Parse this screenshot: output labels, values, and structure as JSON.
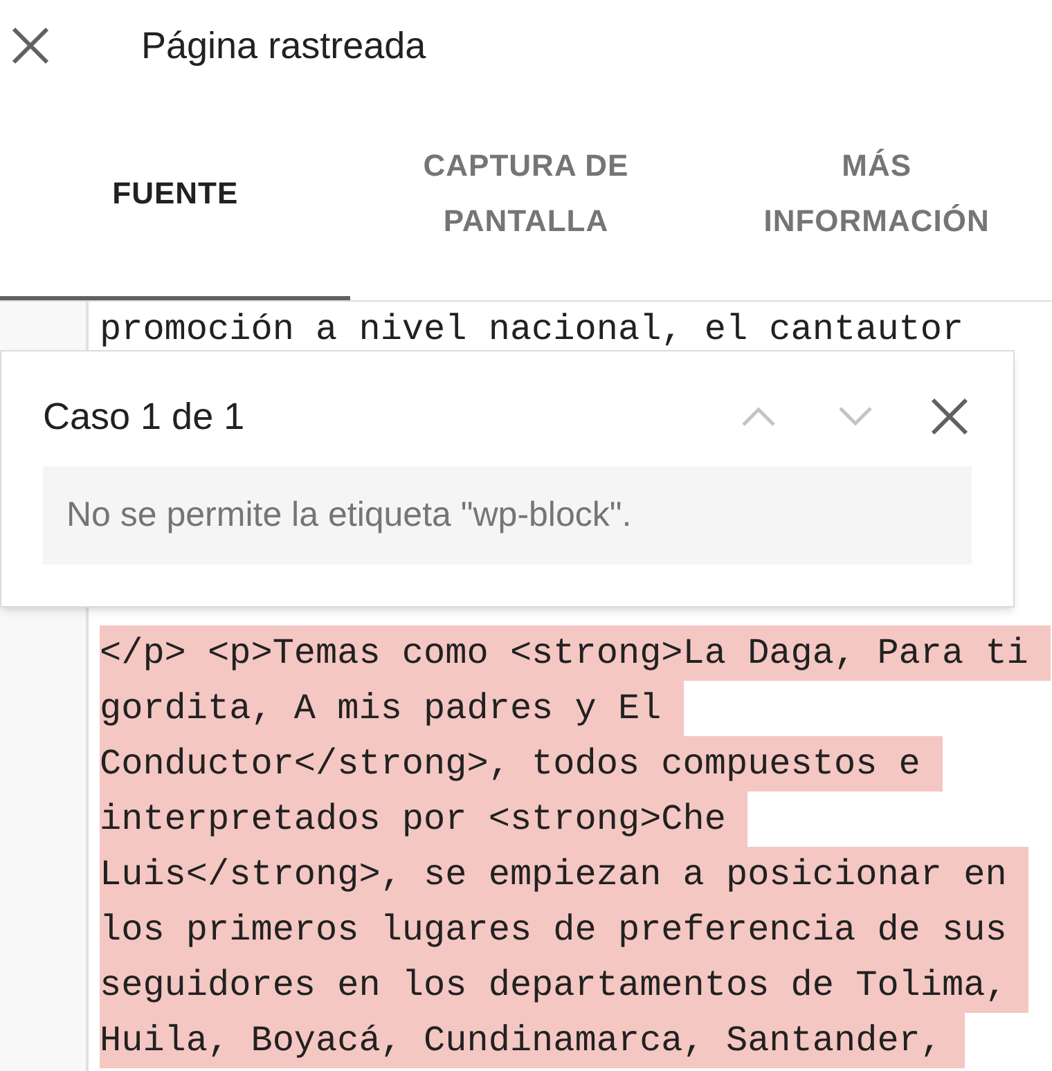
{
  "header": {
    "title": "Página rastreada"
  },
  "tabs": [
    {
      "label": "FUENTE",
      "selected": true
    },
    {
      "label": "CAPTURA DE PANTALLA",
      "selected": false
    },
    {
      "label": "MÁS INFORMACIÓN",
      "selected": false
    }
  ],
  "code_lines": [
    {
      "text": "promoción a nivel nacional, el cantautor",
      "highlighted": false
    },
    {
      "text": "</p> <p>Temas como <strong>La Daga, Para ti",
      "highlighted": true
    },
    {
      "text": "gordita, A mis padres y El",
      "highlighted": true
    },
    {
      "text": "Conductor</strong>, todos compuestos e",
      "highlighted": true
    },
    {
      "text": "interpretados por <strong>Che",
      "highlighted": true
    },
    {
      "text": "Luis</strong>, se empiezan a posicionar en",
      "highlighted": true
    },
    {
      "text": "los primeros lugares de preferencia de sus",
      "highlighted": true
    },
    {
      "text": "seguidores en los departamentos de Tolima,",
      "highlighted": true
    },
    {
      "text": "Huila, Boyacá, Cundinamarca, Santander,",
      "highlighted": true
    }
  ],
  "issue_popup": {
    "title": "Caso 1 de 1",
    "previous_disabled": true,
    "next_disabled": true,
    "message": "No se permite la etiqueta \"wp-block\"."
  }
}
